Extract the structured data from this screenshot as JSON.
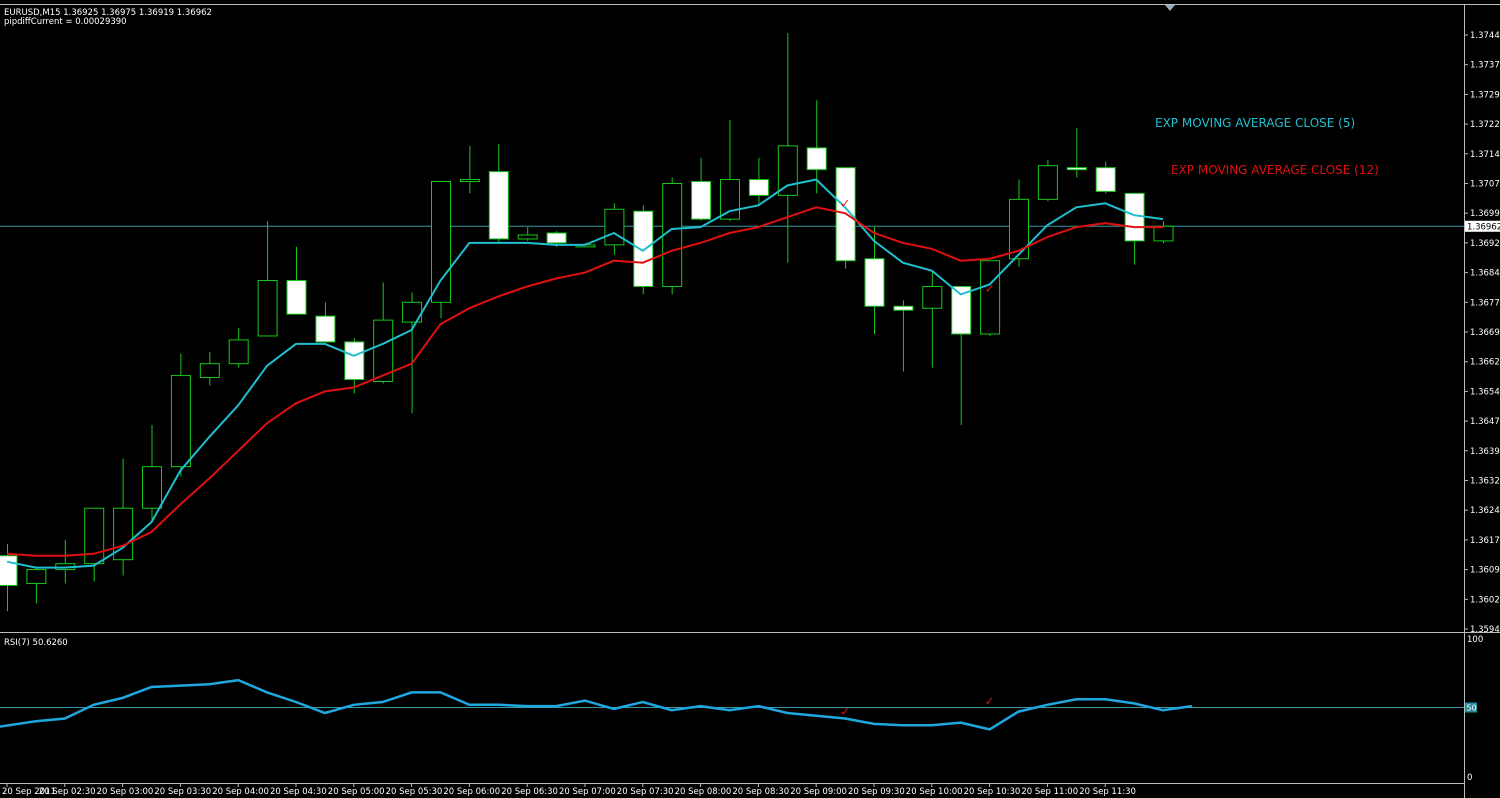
{
  "header": {
    "symbol_line": "EURUSD,M15  1.36925 1.36975 1.36919 1.36962",
    "indicator_line": "pipdiffCurrent = 0.00029390"
  },
  "chart_data": [
    {
      "type": "candlestick",
      "x_labels": [
        "20 Sep 2011",
        "20 Sep 02:30",
        "20 Sep 03:00",
        "20 Sep 03:30",
        "20 Sep 04:00",
        "20 Sep 04:30",
        "20 Sep 05:00",
        "20 Sep 05:30",
        "20 Sep 06:00",
        "20 Sep 06:30",
        "20 Sep 07:00",
        "20 Sep 07:30",
        "20 Sep 08:00",
        "20 Sep 08:30",
        "20 Sep 09:00",
        "20 Sep 09:30",
        "20 Sep 10:00",
        "20 Sep 10:30",
        "20 Sep 11:00",
        "20 Sep 11:30"
      ],
      "y_ticks": [
        "1.37445",
        "1.37370",
        "1.37295",
        "1.37220",
        "1.37145",
        "1.37070",
        "1.36995",
        "1.36920",
        "1.36845",
        "1.36770",
        "1.36695",
        "1.36620",
        "1.36545",
        "1.36470",
        "1.36395",
        "1.36320",
        "1.36245",
        "1.36170",
        "1.36095",
        "1.36020",
        "1.35945"
      ],
      "ylim": [
        1.35945,
        1.37445
      ],
      "current_price": "1.36962",
      "candles": [
        {
          "o": 1.3613,
          "h": 1.3616,
          "l": 1.3599,
          "c": 1.36055
        },
        {
          "o": 1.3606,
          "h": 1.361,
          "l": 1.3601,
          "c": 1.36095
        },
        {
          "o": 1.36095,
          "h": 1.3617,
          "l": 1.3606,
          "c": 1.3611
        },
        {
          "o": 1.3611,
          "h": 1.3614,
          "l": 1.36065,
          "c": 1.3625
        },
        {
          "o": 1.3612,
          "h": 1.36375,
          "l": 1.3608,
          "c": 1.3625
        },
        {
          "o": 1.3625,
          "h": 1.3646,
          "l": 1.3622,
          "c": 1.36355
        },
        {
          "o": 1.36355,
          "h": 1.3664,
          "l": 1.3633,
          "c": 1.36585
        },
        {
          "o": 1.3658,
          "h": 1.36645,
          "l": 1.3656,
          "c": 1.36615
        },
        {
          "o": 1.36615,
          "h": 1.36705,
          "l": 1.36605,
          "c": 1.36675
        },
        {
          "o": 1.36685,
          "h": 1.36975,
          "l": 1.3669,
          "c": 1.36825
        },
        {
          "o": 1.36825,
          "h": 1.3691,
          "l": 1.3674,
          "c": 1.3674
        },
        {
          "o": 1.36735,
          "h": 1.3677,
          "l": 1.3669,
          "c": 1.3667
        },
        {
          "o": 1.3667,
          "h": 1.3668,
          "l": 1.3654,
          "c": 1.36575
        },
        {
          "o": 1.3657,
          "h": 1.3682,
          "l": 1.36565,
          "c": 1.36725
        },
        {
          "o": 1.3672,
          "h": 1.36795,
          "l": 1.3649,
          "c": 1.3677
        },
        {
          "o": 1.3677,
          "h": 1.37075,
          "l": 1.3673,
          "c": 1.37075
        },
        {
          "o": 1.37075,
          "h": 1.37165,
          "l": 1.37045,
          "c": 1.3708
        },
        {
          "o": 1.371,
          "h": 1.3717,
          "l": 1.3692,
          "c": 1.3693
        },
        {
          "o": 1.3693,
          "h": 1.3696,
          "l": 1.36925,
          "c": 1.3694
        },
        {
          "o": 1.36945,
          "h": 1.3695,
          "l": 1.3691,
          "c": 1.3692
        },
        {
          "o": 1.36915,
          "h": 1.3692,
          "l": 1.3691,
          "c": 1.36915
        },
        {
          "o": 1.36915,
          "h": 1.3702,
          "l": 1.3689,
          "c": 1.37005
        },
        {
          "o": 1.37,
          "h": 1.37015,
          "l": 1.3679,
          "c": 1.3681
        },
        {
          "o": 1.3681,
          "h": 1.37085,
          "l": 1.3679,
          "c": 1.3707
        },
        {
          "o": 1.37075,
          "h": 1.37135,
          "l": 1.36975,
          "c": 1.3698
        },
        {
          "o": 1.3698,
          "h": 1.3723,
          "l": 1.36975,
          "c": 1.3708
        },
        {
          "o": 1.3708,
          "h": 1.37135,
          "l": 1.3702,
          "c": 1.3704
        },
        {
          "o": 1.3704,
          "h": 1.3745,
          "l": 1.3687,
          "c": 1.37165
        },
        {
          "o": 1.3716,
          "h": 1.3728,
          "l": 1.37045,
          "c": 1.37105
        },
        {
          "o": 1.3711,
          "h": 1.3711,
          "l": 1.36855,
          "c": 1.36875
        },
        {
          "o": 1.3688,
          "h": 1.3696,
          "l": 1.3669,
          "c": 1.3676
        },
        {
          "o": 1.3676,
          "h": 1.36775,
          "l": 1.36595,
          "c": 1.3675
        },
        {
          "o": 1.36755,
          "h": 1.3685,
          "l": 1.36605,
          "c": 1.3681
        },
        {
          "o": 1.3681,
          "h": 1.3681,
          "l": 1.3646,
          "c": 1.3669
        },
        {
          "o": 1.3669,
          "h": 1.36875,
          "l": 1.36685,
          "c": 1.36875
        },
        {
          "o": 1.3688,
          "h": 1.3708,
          "l": 1.3686,
          "c": 1.3703
        },
        {
          "o": 1.3703,
          "h": 1.3713,
          "l": 1.37025,
          "c": 1.37115
        },
        {
          "o": 1.3711,
          "h": 1.3721,
          "l": 1.37085,
          "c": 1.37105
        },
        {
          "o": 1.3711,
          "h": 1.37125,
          "l": 1.37045,
          "c": 1.3705
        },
        {
          "o": 1.37045,
          "h": 1.37045,
          "l": 1.36865,
          "c": 1.36925
        },
        {
          "o": 1.36925,
          "h": 1.36975,
          "l": 1.36919,
          "c": 1.36962
        }
      ],
      "series": [
        {
          "name": "EXP MOVING AVERAGE CLOSE (5)",
          "color": "#1fbfd0",
          "values": [
            1.36115,
            1.361,
            1.361,
            1.36105,
            1.3615,
            1.36215,
            1.36345,
            1.3643,
            1.3651,
            1.3661,
            1.36665,
            1.36665,
            1.36635,
            1.36665,
            1.367,
            1.36825,
            1.3692,
            1.3692,
            1.3692,
            1.36915,
            1.36915,
            1.36945,
            1.369,
            1.36955,
            1.3696,
            1.37,
            1.37015,
            1.37065,
            1.3708,
            1.3701,
            1.36925,
            1.3687,
            1.3685,
            1.3679,
            1.36815,
            1.3689,
            1.36965,
            1.3701,
            1.3702,
            1.3699,
            1.3698
          ]
        },
        {
          "name": "EXP MOVING AVERAGE CLOSE (12)",
          "color": "#e01010",
          "values": [
            1.36135,
            1.3613,
            1.3613,
            1.36135,
            1.36155,
            1.3619,
            1.3626,
            1.36325,
            1.36395,
            1.36465,
            1.36515,
            1.36545,
            1.36555,
            1.36585,
            1.36615,
            1.36715,
            1.36755,
            1.36785,
            1.3681,
            1.3683,
            1.36845,
            1.36875,
            1.3687,
            1.369,
            1.3692,
            1.36945,
            1.3696,
            1.36985,
            1.3701,
            1.36995,
            1.36945,
            1.3692,
            1.36905,
            1.36875,
            1.3688,
            1.369,
            1.36935,
            1.3696,
            1.3697,
            1.3696,
            1.3696
          ]
        }
      ],
      "markers": [
        {
          "bar": 29,
          "value": 1.3701,
          "color": "#e01010",
          "symbol": "✓"
        },
        {
          "bar": 34,
          "value": 1.36795,
          "color": "#e01010",
          "symbol": "✓"
        }
      ]
    },
    {
      "type": "line",
      "title": "RSI(7) 50.6260",
      "ylim": [
        0,
        100
      ],
      "y_ticks": [
        "100",
        "0"
      ],
      "level": {
        "value": 50,
        "label": "50"
      },
      "series": [
        {
          "name": "RSI(7)",
          "color": "#1fa8e0",
          "values": [
            36,
            40,
            42,
            52,
            57,
            65,
            66,
            67,
            70,
            61,
            54,
            46,
            52,
            54,
            61,
            61,
            52,
            52,
            51,
            51,
            55,
            49,
            54,
            48,
            51,
            48,
            51,
            46,
            44,
            42,
            38,
            37,
            37,
            39,
            34,
            47,
            52,
            56,
            56,
            53,
            48,
            51
          ]
        }
      ],
      "markers": [
        {
          "bar": 29,
          "value": 44,
          "color": "#e01010",
          "symbol": "✓"
        },
        {
          "bar": 34,
          "value": 52,
          "color": "#e01010",
          "symbol": "✓"
        }
      ]
    }
  ]
}
